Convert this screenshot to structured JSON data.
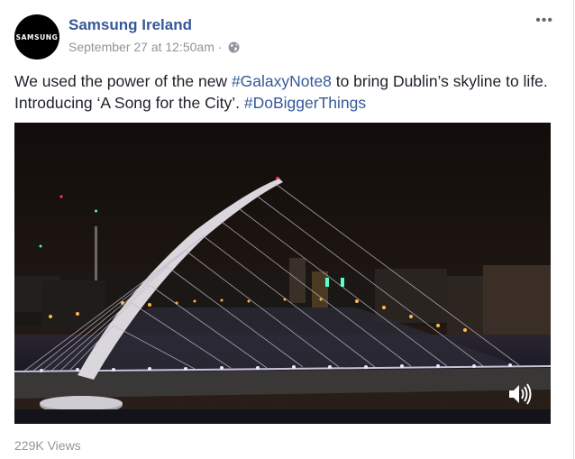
{
  "post": {
    "page_name": "Samsung Ireland",
    "avatar_text": "SAMSUNG",
    "timestamp": "September 27 at 12:50am",
    "separator": "·",
    "privacy_icon": "globe-icon",
    "more_icon": "more-options-icon",
    "more_label": "•••",
    "text_part1": "We used the power of the new ",
    "hashtag1": "#GalaxyNote8",
    "text_part2": " to bring Dublin’s skyline to life. Introducing ‘A Song for the City’. ",
    "hashtag2": "#DoBiggerThings",
    "views": "229K Views"
  },
  "video": {
    "description_icon": "volume-icon"
  },
  "colors": {
    "link": "#365899",
    "meta": "#90949c",
    "text": "#1d2129"
  }
}
